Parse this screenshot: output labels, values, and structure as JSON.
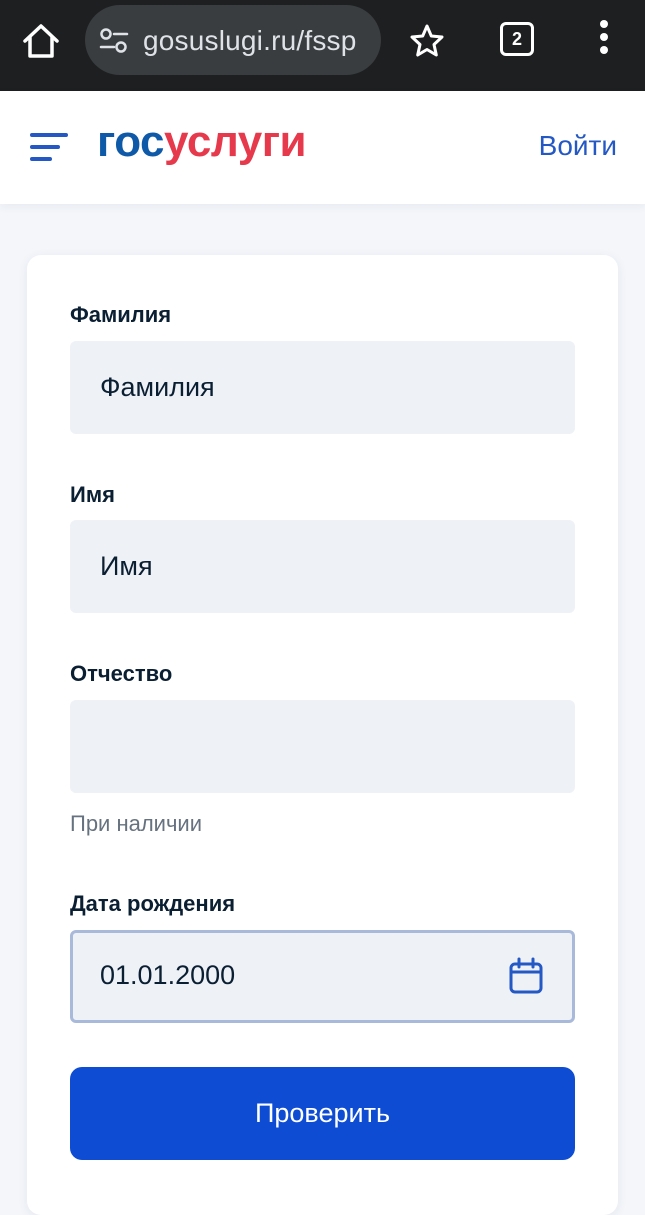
{
  "browser": {
    "url": "gosuslugi.ru/fssp",
    "tabs_count": "2"
  },
  "header": {
    "logo_part1": "гос",
    "logo_part2": "услуги",
    "login_label": "Войти"
  },
  "form": {
    "surname": {
      "label": "Фамилия",
      "placeholder": "Фамилия",
      "value": ""
    },
    "name": {
      "label": "Имя",
      "placeholder": "Имя",
      "value": ""
    },
    "patronymic": {
      "label": "Отчество",
      "placeholder": "",
      "value": "",
      "hint": "При наличии"
    },
    "birthdate": {
      "label": "Дата рождения",
      "value": "01.01.2000"
    },
    "submit_label": "Проверить"
  },
  "colors": {
    "primary": "#0d4cd3",
    "logo_blue": "#0f5aa8",
    "logo_red": "#e63a4c",
    "link": "#2458c4"
  },
  "icons": [
    "home-icon",
    "site-settings-icon",
    "star-icon",
    "tabs-icon",
    "more-icon",
    "menu-icon",
    "calendar-icon"
  ]
}
